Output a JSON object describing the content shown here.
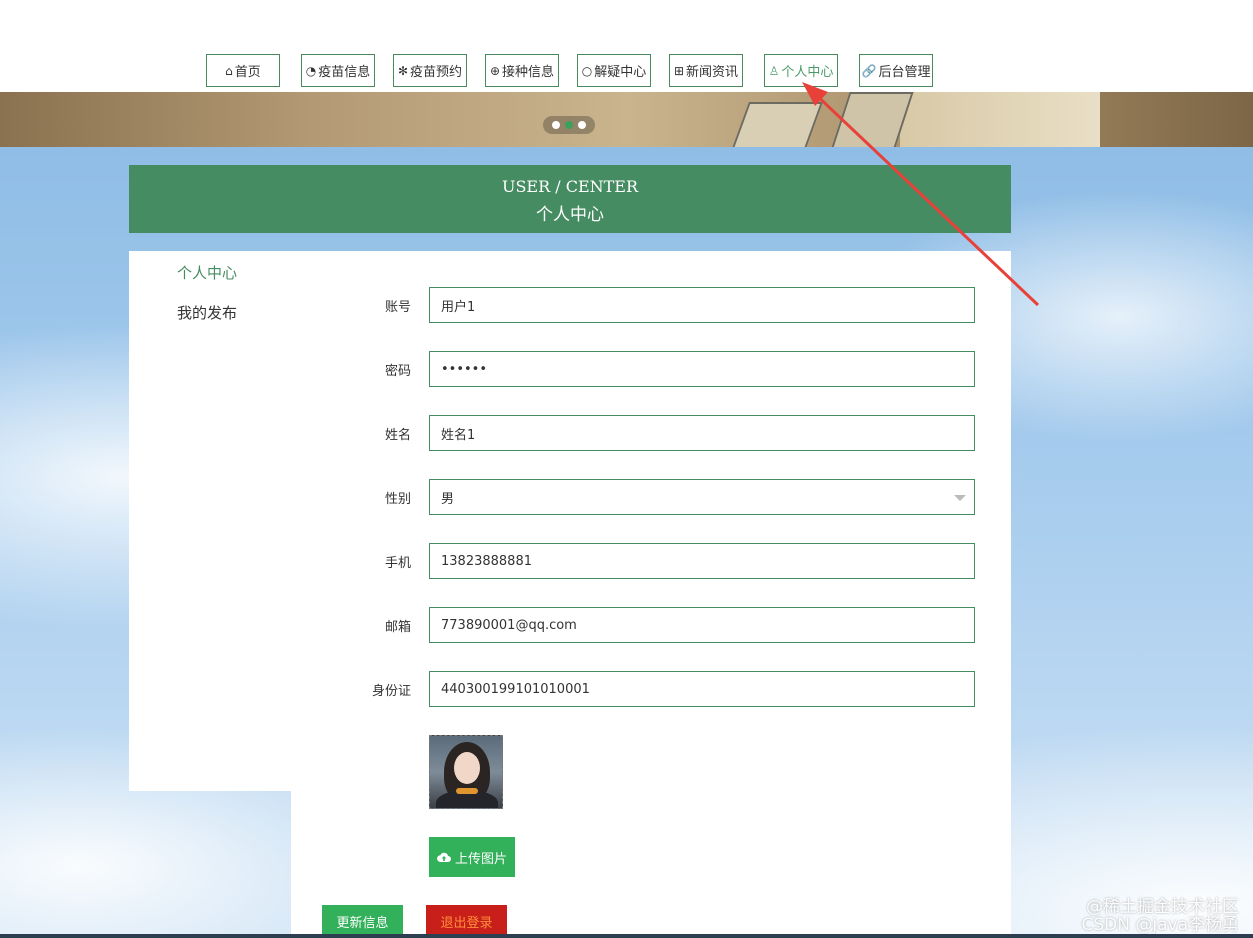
{
  "nav": {
    "items": [
      {
        "icon": "home-icon",
        "glyph": "⌂",
        "label": "首页"
      },
      {
        "icon": "palette-icon",
        "glyph": "◔",
        "label": "疫苗信息"
      },
      {
        "icon": "snowflake-icon",
        "glyph": "✻",
        "label": "疫苗预约"
      },
      {
        "icon": "globe-icon",
        "glyph": "⊕",
        "label": "接种信息"
      },
      {
        "icon": "circle-icon",
        "glyph": "○",
        "label": "解疑中心"
      },
      {
        "icon": "news-icon",
        "glyph": "⊞",
        "label": "新闻资讯"
      },
      {
        "icon": "user-icon",
        "glyph": "♙",
        "label": "个人中心"
      },
      {
        "icon": "link-icon",
        "glyph": "🔗",
        "label": "后台管理"
      }
    ],
    "active_index": 6
  },
  "carousel": {
    "slide_count": 3,
    "active_slide": 2
  },
  "section": {
    "title_en": "USER / CENTER",
    "title_cn": "个人中心"
  },
  "sidebar": {
    "items": [
      {
        "label": "个人中心"
      },
      {
        "label": "我的发布"
      }
    ],
    "active_index": 0
  },
  "form": {
    "account": {
      "label": "账号",
      "value": "用户1"
    },
    "password": {
      "label": "密码",
      "value": "••••••"
    },
    "name": {
      "label": "姓名",
      "value": "姓名1"
    },
    "gender": {
      "label": "性别",
      "value": "男"
    },
    "phone": {
      "label": "手机",
      "value": "13823888881"
    },
    "email": {
      "label": "邮箱",
      "value": "773890001@qq.com"
    },
    "id_card": {
      "label": "身份证",
      "value": "440300199101010001"
    }
  },
  "buttons": {
    "upload": "上传图片",
    "update": "更新信息",
    "logout": "退出登录"
  },
  "watermark": {
    "line1": "@稀土掘金技术社区",
    "line2": "CSDN @java李杨勇"
  },
  "colors": {
    "accent": "#468c62",
    "button_green": "#32b05a",
    "button_red": "#c91f1a",
    "annotation_arrow": "#e8413a"
  }
}
